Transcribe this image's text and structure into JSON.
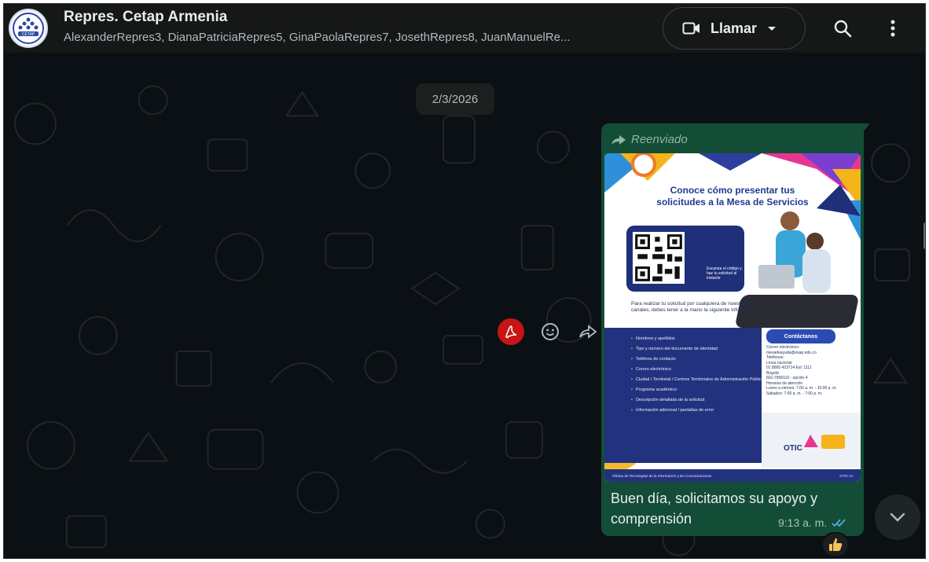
{
  "header": {
    "title": "Repres. Cetap Armenia",
    "participants": "AlexanderRepres3, DianaPatriciaRepres5, GinaPaolaRepres7, JosethRepres8, JuanManuelRe...",
    "avatar_text": "CETAP",
    "call_label": "Llamar",
    "icons": [
      "video-call-icon",
      "chevron-down-icon",
      "search-icon",
      "menu-dots-icon"
    ]
  },
  "date_divider": "2/3/2026",
  "message": {
    "forwarded_label": "Reenviado",
    "text": "Buen día, solicitamos su apoyo y comprensión",
    "time": "9:13 a. m.",
    "status": "read",
    "reaction": "thumbs-up",
    "image": {
      "title_line1": "Conoce cómo presentar tus",
      "title_line2": "solicitudes a la Mesa de Servicios",
      "qr_note": "Escanea el código y haz tu solicitud al instante",
      "intro": "Para realizar tu solicitud por cualquiera de nuestros canales, debes tener a la mano la siguiente información:",
      "list": [
        "Nombres y apellidos",
        "Tipo y número del documento de identidad",
        "Teléfono de contacto",
        "Correo electrónico",
        "Ciudad / Territorial / Centros Territoriales de Administración Pública CETAP",
        "Programa académico",
        "Descripción detallada de la solicitud",
        "Información adicional / pantallas de error"
      ],
      "contact_heading": "Contáctanos",
      "contact_lines": [
        "Correo electrónico:",
        "mesadeayuda@esap.edu.co",
        "Teléfonos:",
        "Línea nacional",
        "01 8000 423714 Ext: 1111",
        "Bogotá",
        "601-7956110 - opción 4",
        "Horarios de atención",
        "Lunes a viernes: 7:00 a. m. - 10:00 p. m.",
        "Sábados: 7:00 a. m. - 7:00 p. m."
      ],
      "brand": "OTIC",
      "footer_left": "Oficina de Tecnologías de la Información y las Comunicaciones",
      "footer_right": "OTIC v4"
    }
  },
  "colors": {
    "background": "#0b1014",
    "header": "#161717",
    "bubble": "#144d37",
    "ticks": "#53bdeb",
    "pdf": "#c81414"
  }
}
